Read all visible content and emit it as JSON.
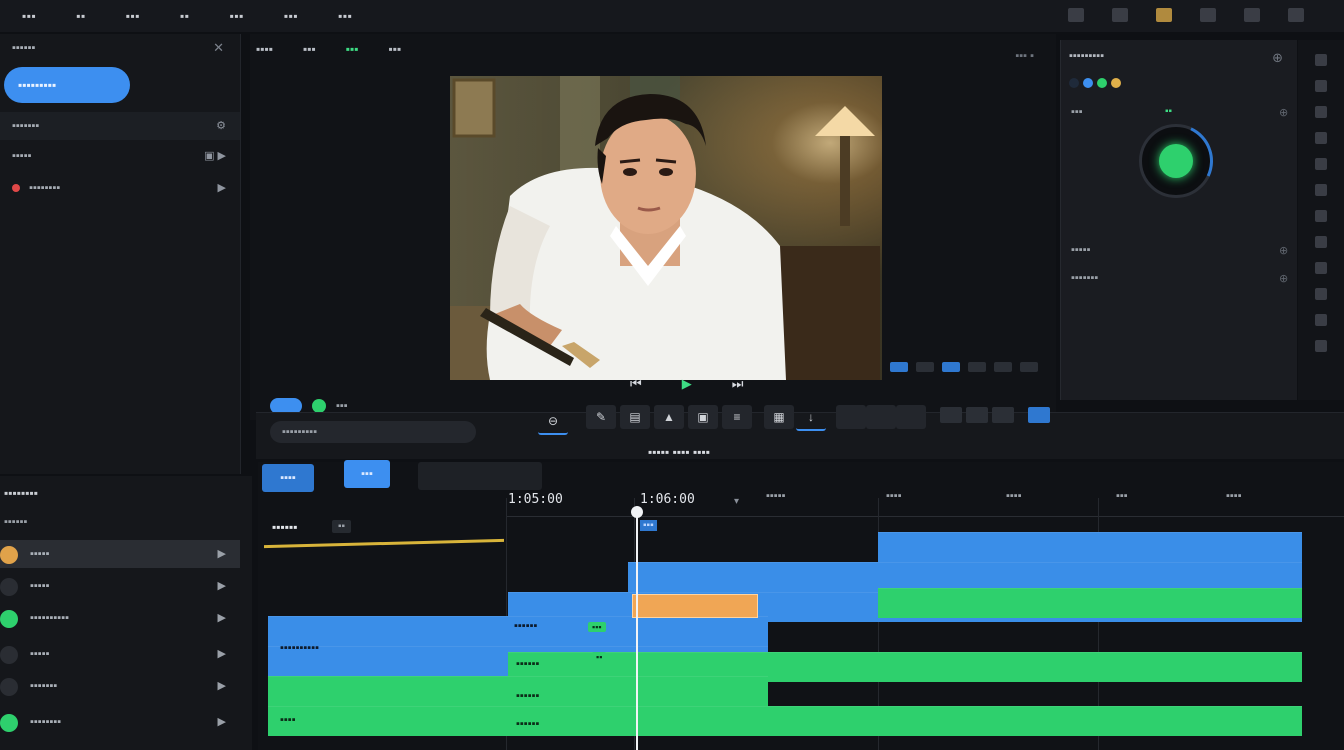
{
  "menu": {
    "items": [
      "▪▪▪",
      "▪▪",
      "▪▪▪",
      "▪▪",
      "▪▪▪",
      "▪▪▪",
      "▪▪▪"
    ]
  },
  "left_panel": {
    "title": "▪▪▪▪▪▪",
    "selected_pill": "▪▪▪▪▪▪▪▪▪",
    "rows": [
      {
        "label": "▪▪▪▪▪▪▪"
      },
      {
        "label": "▪▪▪▪▪"
      },
      {
        "label": "▪▪▪▪▪▪▪▪"
      }
    ]
  },
  "viewer": {
    "tabs": [
      "▪▪▪▪",
      "▪▪▪",
      "▪▪▪",
      "▪▪▪"
    ],
    "active_tab_index": 2,
    "topright": "▪▪▪ ▪",
    "transport": {
      "prev": "⏮",
      "play": "▶",
      "next": "⏭"
    }
  },
  "status": {
    "text": "▪▪▪"
  },
  "inspector": {
    "title": "▪▪▪▪▪▪▪▪▪",
    "knob_value": "▪▪",
    "row1": "▪▪▪",
    "row2": "▪▪▪▪▪",
    "row3": "▪▪▪▪▪▪▪",
    "colors": [
      "#1f2a3a",
      "#3d8ff0",
      "#2ed06d",
      "#e0b04a"
    ]
  },
  "toolbar": {
    "search": "▪▪▪▪▪▪▪▪▪",
    "center_label": "▪▪▪▪▪ ▪▪▪▪ ▪▪▪▪"
  },
  "timeline": {
    "header_buttons": [
      "▪▪▪▪",
      "▪▪▪"
    ],
    "timecodes": [
      "1:05:00",
      "1:06:00"
    ],
    "ruler_labels": [
      "▪▪▪▪▪",
      "▪▪▪▪",
      "▪▪▪▪",
      "▪▪▪",
      "▪▪▪▪"
    ],
    "track_name": "▪▪▪▪▪▪",
    "track_badge": "▪▪",
    "clips": {
      "blue1": "▪▪▪▪▪▪",
      "blue2": "▪▪▪▪▪▪▪▪▪▪",
      "blue3": "▪▪▪▪▪▪▪",
      "green1": "▪▪▪▪▪▪",
      "green2": "▪▪▪▪▪▪",
      "green3": "▪▪▪▪",
      "green4": "▪▪▪▪▪▪",
      "badge1": "▪▪▪",
      "badge2": "▪▪"
    },
    "playhead_label": "▪▪▪"
  },
  "library": {
    "title": "▪▪▪▪▪▪▪▪",
    "subtitle": "▪▪▪▪▪▪",
    "items": [
      "▪▪▪▪▪",
      "▪▪▪▪▪",
      "▪▪▪▪▪▪▪▪▪▪",
      "▪▪▪▪▪",
      "▪▪▪▪▪▪▪",
      "▪▪▪▪▪▪▪▪"
    ]
  }
}
